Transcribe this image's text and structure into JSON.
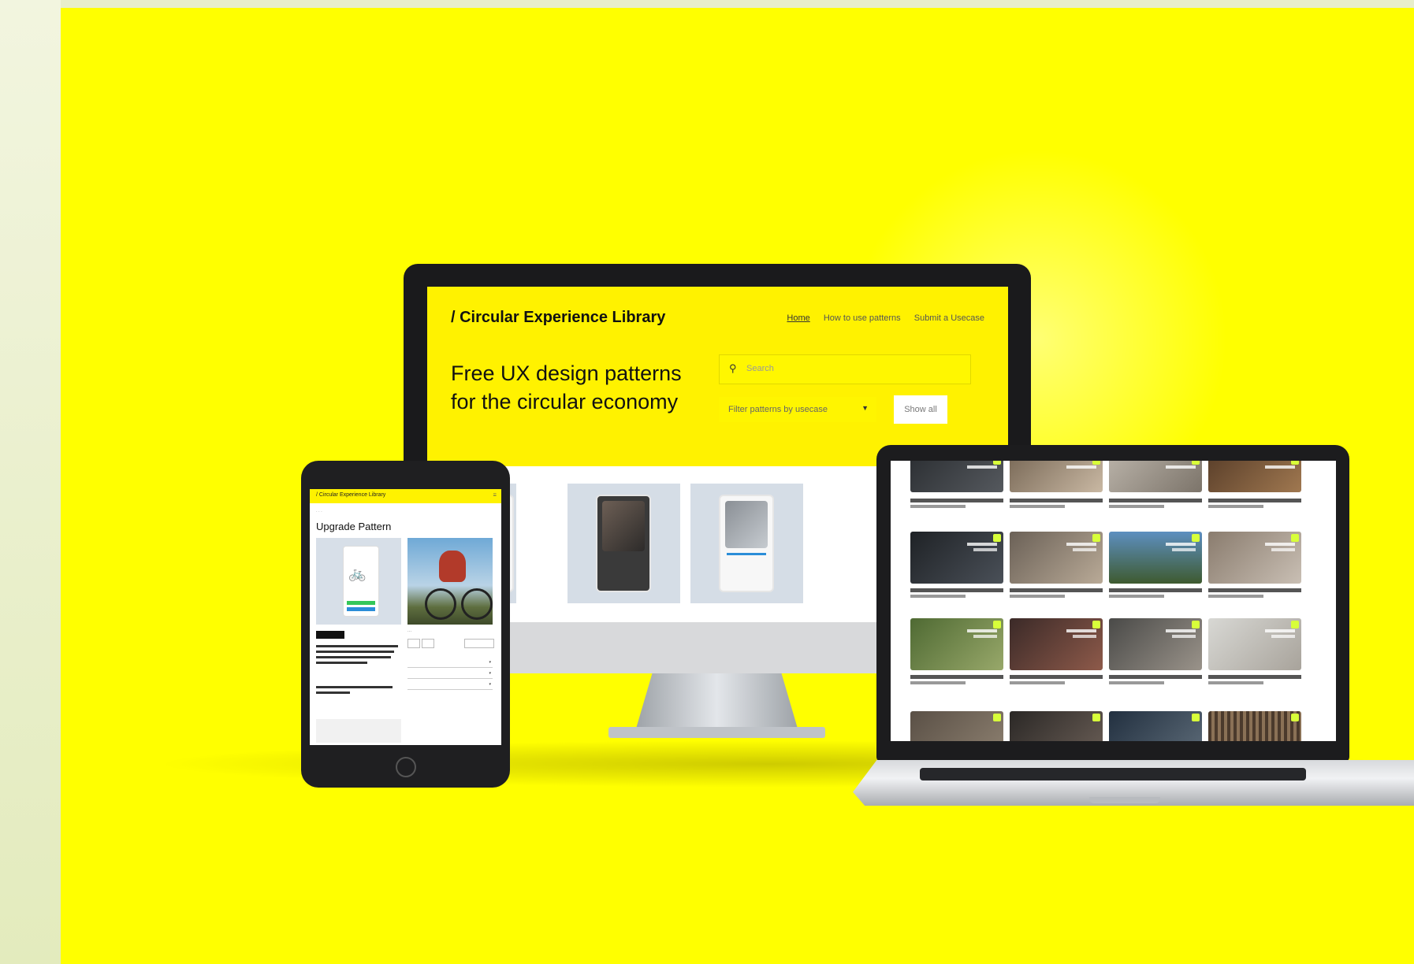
{
  "monitor": {
    "site_title": "/ Circular Experience Library",
    "nav": [
      "Home",
      "How to use patterns",
      "Submit a Usecase"
    ],
    "hero_line1": "Free UX design patterns",
    "hero_line2": "for the circular economy",
    "search_placeholder": "Search",
    "filter_label": "Filter patterns by usecase",
    "show_all_label": "Show all"
  },
  "tablet": {
    "site_title": "/ Circular Experience Library",
    "page_title": "Upgrade Pattern"
  },
  "colors": {
    "background": "#ffff00",
    "brand_yellow": "#fff200",
    "bezel": "#1a1a1c"
  },
  "icons": {
    "search": "search-icon",
    "chevron": "chevron-down-icon",
    "bicycle": "bicycle-icon"
  }
}
